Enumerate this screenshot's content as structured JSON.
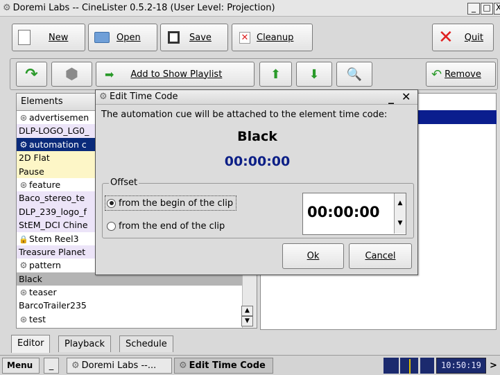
{
  "window": {
    "title": "Doremi Labs -- CineLister 0.5.2-18 (User Level: Projection)",
    "minimize": "_",
    "maximize": "□",
    "close": "X"
  },
  "toolbar": {
    "new": "New",
    "open": "Open",
    "save": "Save",
    "cleanup": "Cleanup",
    "quit": "Quit"
  },
  "actionbar": {
    "add_to_show_playlist": "Add to Show Playlist",
    "remove": "Remove"
  },
  "elements": {
    "header": "Elements",
    "items": [
      {
        "label": "advertisemen",
        "icon": "reel-icon",
        "bg": "#ffffff"
      },
      {
        "label": "DLP-LOGO_LG0_",
        "icon": "",
        "bg": "#ece4f8"
      },
      {
        "label": "automation c",
        "icon": "gear-icon",
        "bg": "#0a2a7a",
        "selected": true
      },
      {
        "label": "2D Flat",
        "icon": "",
        "bg": "#fdf6c7"
      },
      {
        "label": "Pause",
        "icon": "",
        "bg": "#fdf6c7"
      },
      {
        "label": "feature",
        "icon": "reel-icon",
        "bg": "#ffffff"
      },
      {
        "label": "Baco_stereo_te",
        "icon": "",
        "bg": "#ece4f8"
      },
      {
        "label": "DLP_239_logo_f",
        "icon": "",
        "bg": "#ece4f8"
      },
      {
        "label": "StEM_DCI Chine",
        "icon": "",
        "bg": "#ece4f8"
      },
      {
        "label": "Stem Reel3",
        "icon": "lock-icon",
        "bg": "#ffffff"
      },
      {
        "label": "Treasure Planet",
        "icon": "",
        "bg": "#ece4f8"
      },
      {
        "label": "pattern",
        "icon": "gear-icon",
        "bg": "#ffffff"
      },
      {
        "label": "Black",
        "icon": "",
        "bg": "#b4b4b4"
      },
      {
        "label": "teaser",
        "icon": "reel-icon",
        "bg": "#ffffff"
      },
      {
        "label": "BarcoTrailer235",
        "icon": "",
        "bg": "#ffffff"
      },
      {
        "label": "test",
        "icon": "reel-icon",
        "bg": "#ffffff"
      }
    ]
  },
  "dialog": {
    "title": "Edit Time Code",
    "message": "The automation cue will be attached to the element time code:",
    "element_name": "Black",
    "timecode": "00:00:00",
    "offset_legend": "Offset",
    "option_begin": "from the begin of the clip",
    "option_end": "from the end of the clip",
    "selected_option": "begin",
    "offset_value": "00:00:00",
    "ok": "Ok",
    "cancel": "Cancel"
  },
  "tabs": [
    {
      "label": "Editor",
      "active": true
    },
    {
      "label": "Playback",
      "active": false
    },
    {
      "label": "Schedule",
      "active": false
    }
  ],
  "taskbar": {
    "menu": "Menu",
    "minimize": "_",
    "task1": "Doremi Labs --...",
    "task2": "Edit Time Code",
    "clock": "10:50:19",
    "more": ">"
  },
  "colors": {
    "selection": "#0a2a7a",
    "timecode_blue": "#0c1f86",
    "clock_bg": "#1b2a6e"
  }
}
